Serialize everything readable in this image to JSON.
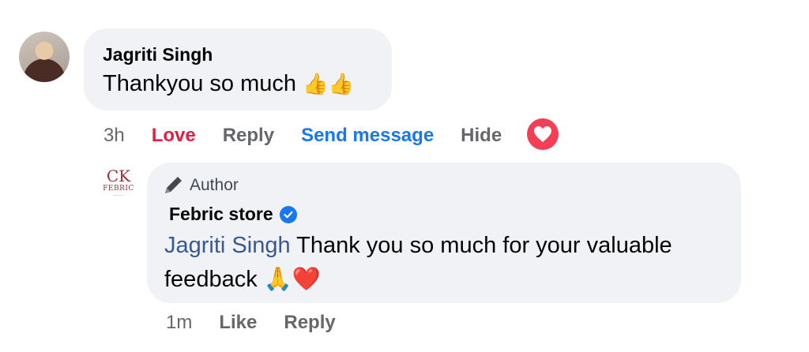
{
  "comment": {
    "author": "Jagriti Singh",
    "text": "Thankyou so much",
    "emoji": "👍👍",
    "actions": {
      "time": "3h",
      "love": "Love",
      "reply": "Reply",
      "send_message": "Send message",
      "hide": "Hide"
    },
    "reaction_icon": "heart-reaction-icon"
  },
  "reply": {
    "page_logo": {
      "monogram": "CK",
      "brand": "FEBRIC"
    },
    "badge_label": "Author",
    "author": "Febric store",
    "verified_icon": "verified-badge-icon",
    "mention": "Jagriti Singh",
    "text": "Thank you so much for your valuable feedback",
    "emoji": "🙏❤️",
    "actions": {
      "time": "1m",
      "like": "Like",
      "reply": "Reply"
    }
  },
  "colors": {
    "bubble": "#f0f2f5",
    "love_red": "#e41e3f",
    "link_blue": "#1877f2",
    "mention_blue": "#385898",
    "muted": "#65676b"
  }
}
